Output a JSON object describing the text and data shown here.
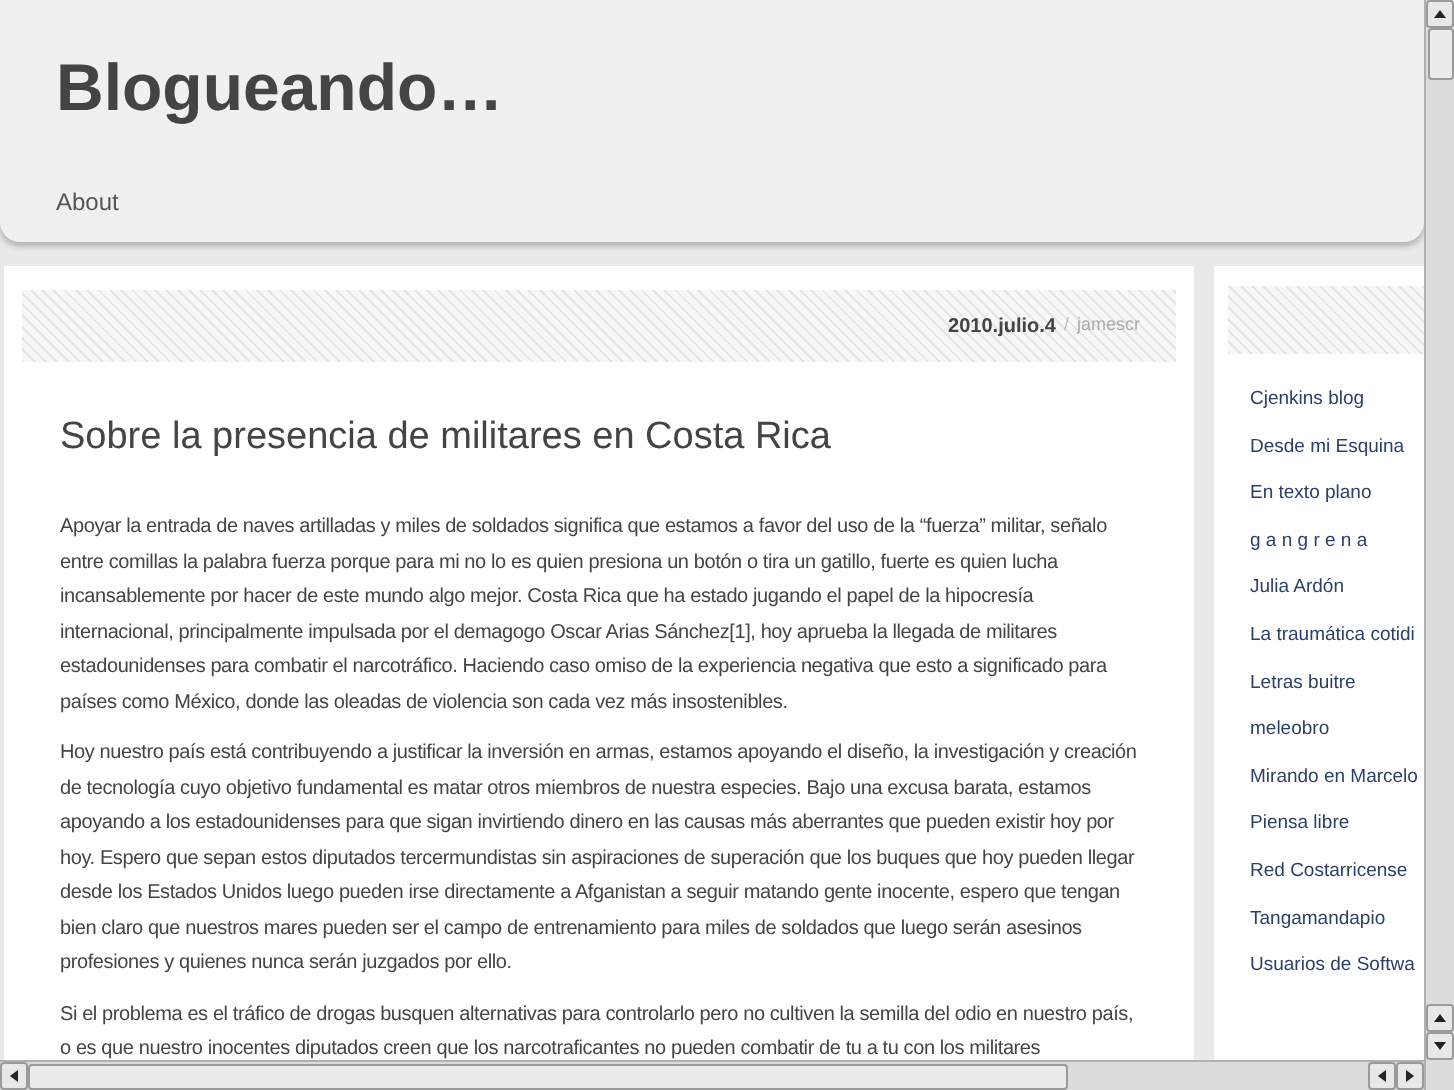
{
  "header": {
    "title": "Blogueando…",
    "nav": [
      {
        "label": "About"
      }
    ]
  },
  "post": {
    "date": "2010.julio.4",
    "separator": "/",
    "author": "jamescr",
    "title": "Sobre la presencia de militares en Costa Rica",
    "paragraphs": [
      "Apoyar la entrada de naves artilladas y miles de soldados significa que estamos a favor del uso de la “fuerza” militar, señalo entre comillas la palabra fuerza porque para mi no lo es quien presiona un botón o tira un gatillo, fuerte es quien lucha incansablemente por hacer de este mundo algo mejor. Costa Rica que ha estado jugando el papel de la hipocresía internacional, principalmente impulsada por el demagogo Oscar Arias Sánchez[1], hoy aprueba la llegada de militares estadounidenses para combatir el narcotráfico. Haciendo caso omiso de la experiencia negativa que esto a significado para países como México, donde las oleadas de violencia son cada vez más insostenibles.",
      "Hoy nuestro país está contribuyendo a justificar la inversión en armas, estamos apoyando el diseño, la investigación y creación de tecnología cuyo objetivo fundamental es matar otros miembros de nuestra especies. Bajo una excusa barata, estamos apoyando a los estadounidenses para que sigan invirtiendo dinero en las causas más aberrantes que pueden existir hoy por hoy. Espero que sepan estos diputados tercermundistas sin aspiraciones de superación que los buques que hoy pueden llegar desde los Estados Unidos luego pueden irse directamente a Afganistan a seguir matando gente inocente, espero que tengan bien claro que nuestros mares pueden ser el campo de entrenamiento para miles de soldados que luego serán asesinos profesiones y quienes nunca serán juzgados por ello.",
      "Si el problema es el tráfico de drogas busquen alternativas para controlarlo pero no cultiven la semilla del odio en nuestro país, o es que nuestro inocentes diputados creen que los narcotraficantes no pueden combatir de tu a tu con los militares"
    ]
  },
  "sidebar": {
    "links": [
      "Cjenkins blog",
      "Desde mi Esquina",
      "En texto plano",
      "g a n g r e n a",
      "Julia Ardón",
      "La traumática cotidi",
      "Letras buitre",
      "meleobro",
      "Mirando en Marcelo",
      "Piensa libre",
      "Red Costarricense",
      "Tangamandapio",
      "Usuarios de Softwa"
    ]
  }
}
